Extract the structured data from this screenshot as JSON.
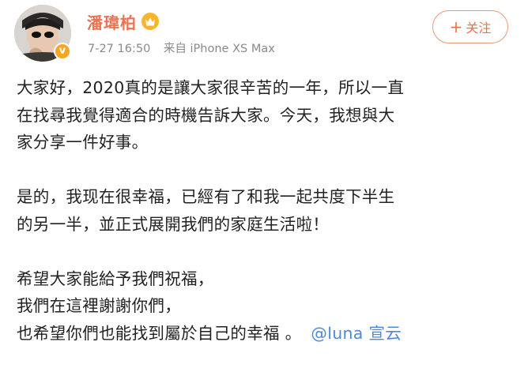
{
  "header": {
    "user_name": "潘瑋柏",
    "time": "7-27 16:50",
    "source": "来自 iPhone XS Max",
    "follow_label": "关注",
    "follow_plus": "+",
    "verified_symbol": "v"
  },
  "post": {
    "p1": [
      "大家好，2020真的是讓大家很辛苦的一年，所以一直",
      "在找尋我覺得適合的時機告訴大家。今天，我想與大",
      "家分享一件好事。"
    ],
    "p2": [
      "是的，我现在很幸福，已經有了和我一起共度下半生",
      "的另一半，並正式展開我們的家庭生活啦！"
    ],
    "p3": [
      "希望大家能給予我們祝福，",
      "我們在這裡謝謝你們，",
      "也希望你們也能找到屬於自己的幸福 。"
    ],
    "mention": "@luna 宣云"
  },
  "colors": {
    "name": "#eb7350",
    "mention": "#4c8ad8",
    "follow": "#e8734a",
    "meta": "#8a8a8a",
    "badge": "#f6a623"
  },
  "icons": {
    "avatar": "user-avatar",
    "verified": "verified-badge-icon",
    "crown": "crown-icon"
  }
}
